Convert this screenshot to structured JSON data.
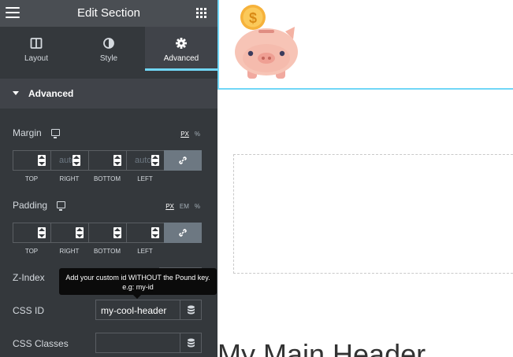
{
  "header": {
    "title": "Edit Section"
  },
  "tabs": [
    {
      "label": "Layout"
    },
    {
      "label": "Style"
    },
    {
      "label": "Advanced"
    }
  ],
  "section": {
    "title": "Advanced"
  },
  "margin": {
    "label": "Margin",
    "units": [
      "PX",
      "%"
    ],
    "active_unit": "PX",
    "fields": [
      {
        "label": "TOP",
        "value": ""
      },
      {
        "label": "RIGHT",
        "value": "auto"
      },
      {
        "label": "BOTTOM",
        "value": ""
      },
      {
        "label": "LEFT",
        "value": "auto"
      }
    ]
  },
  "padding": {
    "label": "Padding",
    "units": [
      "PX",
      "EM",
      "%"
    ],
    "active_unit": "PX",
    "fields": [
      {
        "label": "TOP",
        "value": ""
      },
      {
        "label": "RIGHT",
        "value": ""
      },
      {
        "label": "BOTTOM",
        "value": ""
      },
      {
        "label": "LEFT",
        "value": ""
      }
    ]
  },
  "zindex": {
    "label": "Z-Index"
  },
  "tooltip": {
    "text": "Add your custom id WITHOUT the Pound key. e.g: my-id"
  },
  "css_id": {
    "label": "CSS ID",
    "value": "my-cool-header"
  },
  "css_classes": {
    "label": "CSS Classes",
    "value": ""
  },
  "canvas": {
    "heading": "My Main Header",
    "icon": "piggy-bank-icon",
    "accent": "#71d7f7"
  }
}
